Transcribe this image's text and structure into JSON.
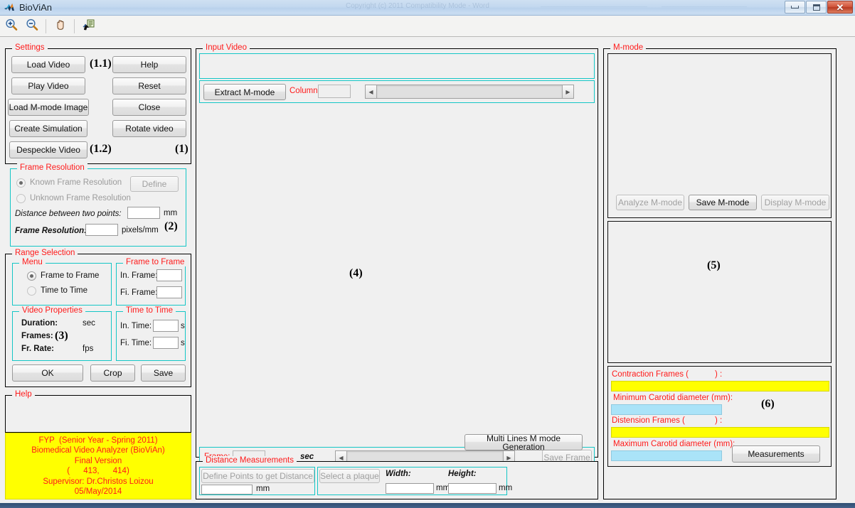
{
  "window": {
    "title": "BioViAn",
    "app_icon": "matlab-logo-icon",
    "controls": {
      "minimize": "minimize",
      "maximize": "maximize",
      "close": "close"
    },
    "ghost_text": "Copyright (c) 2011 Compatibility Mode - Word"
  },
  "toolbar": {
    "items": [
      {
        "name": "zoom-in-icon",
        "label": "Zoom In"
      },
      {
        "name": "zoom-out-icon",
        "label": "Zoom Out"
      },
      {
        "name": "pan-hand-icon",
        "label": "Pan"
      },
      {
        "name": "data-cursor-icon",
        "label": "Data Cursor"
      }
    ]
  },
  "settings": {
    "title": "Settings",
    "marker": "(1)",
    "buttons_left": [
      {
        "label": "Load Video",
        "disabled": false
      },
      {
        "label": "Play Video",
        "disabled": false
      },
      {
        "label": "Load M-mode Image",
        "disabled": false
      },
      {
        "label": "Create Simulation",
        "disabled": false
      },
      {
        "label": "Despeckle Video",
        "disabled": false
      }
    ],
    "buttons_right": [
      {
        "label": "Help",
        "disabled": false
      },
      {
        "label": "Reset",
        "disabled": false
      },
      {
        "label": "Close",
        "disabled": false
      },
      {
        "label": "Rotate video",
        "disabled": false
      }
    ],
    "marker_load_video": "(1.1)",
    "marker_despeckle": "(1.2)"
  },
  "frame_resolution": {
    "title": "Frame Resolution",
    "marker": "(2)",
    "radio_known": {
      "label": "Known Frame Resolution",
      "selected": true,
      "disabled": true
    },
    "radio_unknown": {
      "label": "Unknown Frame Resolution",
      "selected": false,
      "disabled": true
    },
    "define_button": {
      "label": "Define",
      "disabled": true
    },
    "distance_label": "Distance between two points:",
    "distance_value": "",
    "distance_unit": "mm",
    "resolution_label": "Frame Resolution:",
    "resolution_value": "",
    "resolution_unit": "pixels/mm"
  },
  "range_selection": {
    "title": "Range Selection",
    "menu": {
      "title": "Menu",
      "options": [
        {
          "label": "Frame to Frame",
          "selected": true
        },
        {
          "label": "Time to Time",
          "selected": false
        }
      ]
    },
    "frame_to_frame": {
      "title": "Frame to Frame",
      "in_label": "In. Frame:",
      "in_value": "",
      "fi_label": "Fi. Frame:",
      "fi_value": ""
    },
    "video_properties": {
      "title": "Video Properties",
      "marker": "(3)",
      "rows": [
        {
          "label": "Duration:",
          "value": "",
          "unit": "sec"
        },
        {
          "label": "Frames:",
          "value": "",
          "unit": ""
        },
        {
          "label": "Fr. Rate:",
          "value": "",
          "unit": "fps"
        }
      ]
    },
    "time_to_time": {
      "title": "Time to Time",
      "in_label": "In. Time:",
      "in_value": "",
      "in_unit": "s",
      "fi_label": "Fi. Time:",
      "fi_value": "",
      "fi_unit": "s"
    },
    "action_buttons": [
      {
        "label": "OK"
      },
      {
        "label": "Crop"
      },
      {
        "label": "Save"
      }
    ]
  },
  "help": {
    "title": "Help",
    "text": "",
    "banner_lines": [
      "FYP  (Senior Year - Spring 2011)",
      "Biomedical Video Analyzer (BioViAn)",
      "Final Version",
      "(      413,      414)",
      "Supervisor: Dr.Christos Loizou",
      "05/May/2014"
    ]
  },
  "input_video": {
    "title": "Input Video",
    "marker": "(4)",
    "extract_button": {
      "label": "Extract M-mode"
    },
    "column_label": "Column:",
    "column_value": "",
    "column_slider": {
      "name": "column-slider"
    },
    "frame_label": "Frame:",
    "frame_value": "",
    "frame_unit": "sec",
    "frame_slider": {
      "name": "frame-slider"
    },
    "save_frame_button": {
      "label": "Save Frame",
      "disabled": true
    },
    "multi_lines_button": {
      "label": "Multi Lines M mode Generation"
    }
  },
  "distance_measurements": {
    "title": "Distance Measurements",
    "define_points_button": {
      "label": "Define Points to get Distance",
      "disabled": true
    },
    "distance_value": "",
    "distance_unit": "mm",
    "select_plaque_button": {
      "label": "Select a plaque",
      "disabled": true
    },
    "width_label": "Width:",
    "width_value": "",
    "width_unit": "mm",
    "height_label": "Height:",
    "height_value": "",
    "height_unit": "mm"
  },
  "mmode": {
    "title": "M-mode",
    "marker_5": "(5)",
    "marker_6": "(6)",
    "buttons": [
      {
        "label": "Analyze M-mode",
        "disabled": true
      },
      {
        "label": "Save M-mode",
        "disabled": false
      },
      {
        "label": "Display M-mode",
        "disabled": true
      }
    ],
    "results": {
      "contraction_label_pre": "Contraction Frames (",
      "contraction_label_post": ") :",
      "contraction_count": "",
      "contraction_value": "",
      "min_diameter_label": "Minimum Carotid diameter (mm):",
      "min_diameter_value": "",
      "distension_label_pre": "Distension Frames (",
      "distension_label_post": ") :",
      "distension_count": "",
      "distension_value": "",
      "max_diameter_label": "Maximum Carotid diameter (mm):",
      "max_diameter_value": "",
      "measurements_button": {
        "label": "Measurements"
      }
    }
  },
  "colors": {
    "panel_title": "#ff1a1a",
    "panel_border_cyan": "#14c6c6",
    "highlight_yellow": "#ffff00",
    "highlight_cyan": "#aae3f8",
    "window_background": "#f0f0f0"
  }
}
